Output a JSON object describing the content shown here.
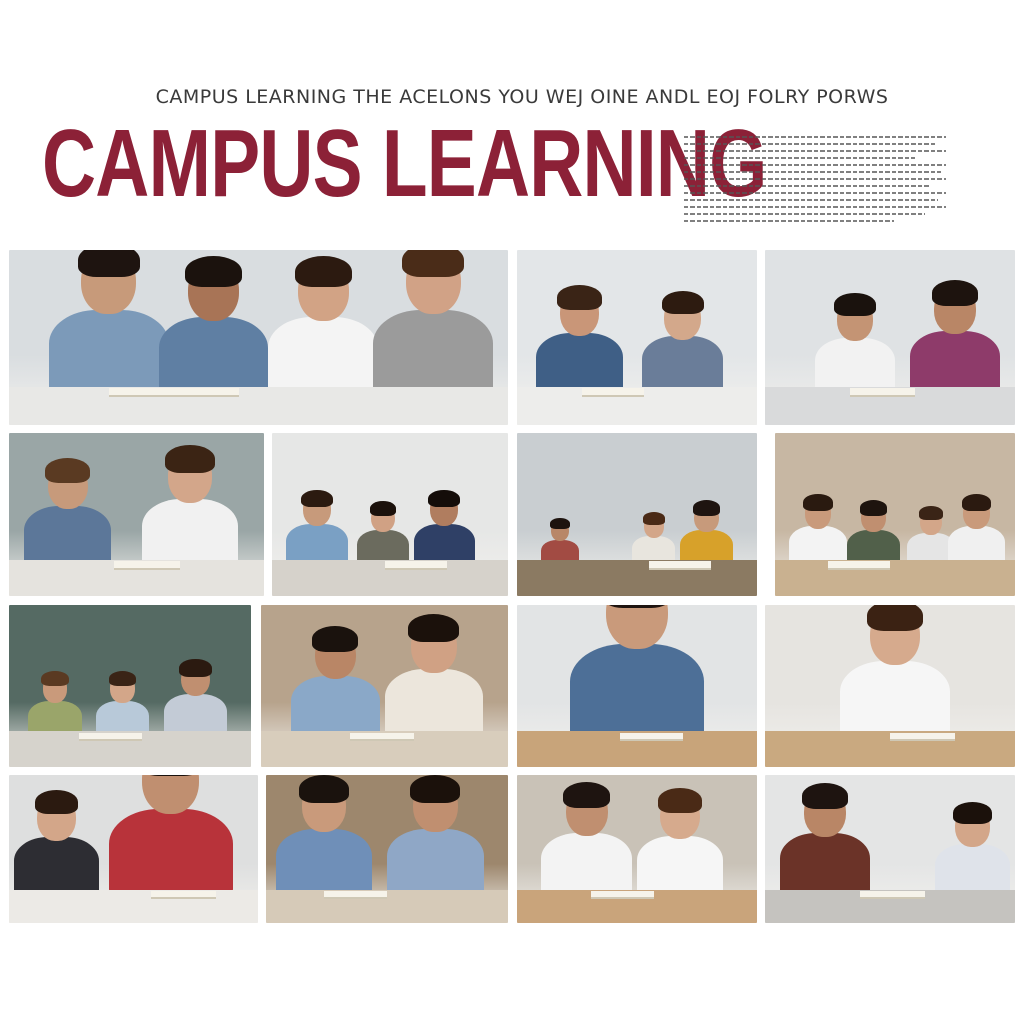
{
  "header": {
    "subtitle": "CAMPUS LEARNING THE ACELONS YOU WEJ OINE ANDL EOJ FOLRY PORWS",
    "title": "CAMPUS LEARNING"
  },
  "colors": {
    "title": "#8c2137",
    "subtitle": "#3a3a3a"
  },
  "photos": [
    {
      "name": "students-reading-group",
      "bg": "#d9dde0",
      "desk": "#e8e8e6",
      "people": [
        {
          "x": 8,
          "w": 24,
          "skin": "#c79a7a",
          "shirt": "#7c9ab9",
          "hair": "#1e1410"
        },
        {
          "x": 30,
          "w": 22,
          "skin": "#a87456",
          "shirt": "#5f7fa3",
          "hair": "#1b120d"
        },
        {
          "x": 52,
          "w": 22,
          "skin": "#d2a385",
          "shirt": "#f4f4f4",
          "hair": "#2c1a10"
        },
        {
          "x": 73,
          "w": 24,
          "skin": "#d1a286",
          "shirt": "#9b9b9b",
          "hair": "#4a2c18"
        }
      ]
    },
    {
      "name": "students-laptop-duo",
      "bg": "#e3e6e8",
      "desk": "#ededeb",
      "people": [
        {
          "x": 8,
          "w": 36,
          "skin": "#c99678",
          "shirt": "#3f5f86",
          "hair": "#3a2416"
        },
        {
          "x": 52,
          "w": 34,
          "skin": "#d3a88b",
          "shirt": "#6a7d99",
          "hair": "#2d1b10"
        }
      ]
    },
    {
      "name": "students-desk-pair",
      "bg": "#dfe2e4",
      "desk": "#d9dadb",
      "people": [
        {
          "x": 20,
          "w": 32,
          "skin": "#c49474",
          "shirt": "#f2f2f2",
          "hair": "#1a120d"
        },
        {
          "x": 58,
          "w": 36,
          "skin": "#b98666",
          "shirt": "#8e3b6a",
          "hair": "#1d130e"
        }
      ]
    },
    {
      "name": "students-study-window",
      "bg": "#9aa6a6",
      "desk": "#e5e3de",
      "people": [
        {
          "x": 6,
          "w": 34,
          "skin": "#c79a7b",
          "shirt": "#5c7799",
          "hair": "#5a3a22"
        },
        {
          "x": 52,
          "w": 38,
          "skin": "#d3a68a",
          "shirt": "#f1f1f1",
          "hair": "#3b2414"
        }
      ]
    },
    {
      "name": "students-classroom-whiteboard",
      "bg": "#e6e7e6",
      "desk": "#d6d2cb",
      "people": [
        {
          "x": 6,
          "w": 26,
          "skin": "#c79a7b",
          "shirt": "#7aa0c4",
          "hair": "#2b1a10"
        },
        {
          "x": 36,
          "w": 22,
          "skin": "#d0a184",
          "shirt": "#6b6b5e",
          "hair": "#1b110b"
        },
        {
          "x": 60,
          "w": 26,
          "skin": "#b07d5f",
          "shirt": "#2f4066",
          "hair": "#140d09"
        }
      ]
    },
    {
      "name": "students-library-hall",
      "bg": "#c9ced1",
      "desk": "#8b7a62",
      "people": [
        {
          "x": 10,
          "w": 16,
          "skin": "#b88768",
          "shirt": "#a24b43",
          "hair": "#1d130e"
        },
        {
          "x": 48,
          "w": 18,
          "skin": "#d3a689",
          "shirt": "#e8e5de",
          "hair": "#4a2a16"
        },
        {
          "x": 68,
          "w": 22,
          "skin": "#c79a7b",
          "shirt": "#d7a12a",
          "hair": "#1e1410"
        }
      ]
    },
    {
      "name": "students-group-table",
      "bg": "#c7b7a3",
      "desk": "#c9b190",
      "people": [
        {
          "x": 6,
          "w": 24,
          "skin": "#c99a7b",
          "shirt": "#f3f3f3",
          "hair": "#2a1a10"
        },
        {
          "x": 30,
          "w": 22,
          "skin": "#c08f70",
          "shirt": "#51604a",
          "hair": "#1e140e"
        },
        {
          "x": 55,
          "w": 20,
          "skin": "#d3a689",
          "shirt": "#e5e5e5",
          "hair": "#3a2416"
        },
        {
          "x": 72,
          "w": 24,
          "skin": "#c99a7b",
          "shirt": "#f0f0f0",
          "hair": "#2b1a10"
        }
      ]
    },
    {
      "name": "students-round-table",
      "bg": "#556a63",
      "desk": "#d6d3cc",
      "people": [
        {
          "x": 8,
          "w": 22,
          "skin": "#c99a7b",
          "shirt": "#9aa56a",
          "hair": "#5a3a22"
        },
        {
          "x": 36,
          "w": 22,
          "skin": "#d3a689",
          "shirt": "#b8c9d9",
          "hair": "#3a2416"
        },
        {
          "x": 64,
          "w": 26,
          "skin": "#c08f70",
          "shirt": "#c3cbd6",
          "hair": "#2b1a10"
        }
      ]
    },
    {
      "name": "students-library-reading",
      "bg": "#b7a38c",
      "desk": "#d8cdbc",
      "people": [
        {
          "x": 12,
          "w": 36,
          "skin": "#b98666",
          "shirt": "#8aa8c8",
          "hair": "#1a120d"
        },
        {
          "x": 50,
          "w": 40,
          "skin": "#d0a184",
          "shirt": "#ece6dc",
          "hair": "#1b110b"
        }
      ]
    },
    {
      "name": "student-writing-notes",
      "bg": "#e2e4e5",
      "desk": "#c8a47a",
      "people": [
        {
          "x": 22,
          "w": 56,
          "skin": "#c99a7b",
          "shirt": "#4d6f97",
          "hair": "#1e1410"
        }
      ]
    },
    {
      "name": "student-smiling-writing",
      "bg": "#e6e4e0",
      "desk": "#c9a980",
      "people": [
        {
          "x": 30,
          "w": 44,
          "skin": "#d6aa8d",
          "shirt": "#f6f6f6",
          "hair": "#3b2213"
        }
      ]
    },
    {
      "name": "students-notebook-pair",
      "bg": "#dedfdf",
      "desk": "#eceae6",
      "people": [
        {
          "x": 2,
          "w": 34,
          "skin": "#d3a689",
          "shirt": "#2d2d33",
          "hair": "#2b1a10"
        },
        {
          "x": 40,
          "w": 50,
          "skin": "#c08f70",
          "shirt": "#b8333a",
          "hair": "#1a120d"
        }
      ]
    },
    {
      "name": "students-bookshelf-pair",
      "bg": "#9d876d",
      "desk": "#d6cab8",
      "people": [
        {
          "x": 4,
          "w": 40,
          "skin": "#c99a7b",
          "shirt": "#6f8fb8",
          "hair": "#1a120d"
        },
        {
          "x": 50,
          "w": 40,
          "skin": "#c08f70",
          "shirt": "#8fa7c6",
          "hair": "#1b110b"
        }
      ]
    },
    {
      "name": "students-cafeteria-books",
      "bg": "#c9c2b7",
      "desk": "#c9a47b",
      "people": [
        {
          "x": 10,
          "w": 38,
          "skin": "#c08f70",
          "shirt": "#f3f3f3",
          "hair": "#1e1410"
        },
        {
          "x": 50,
          "w": 36,
          "skin": "#d6aa8d",
          "shirt": "#f6f6f6",
          "hair": "#4a2a16"
        }
      ]
    },
    {
      "name": "students-laptop-classroom",
      "bg": "#e4e5e5",
      "desk": "#c5c3bf",
      "people": [
        {
          "x": 6,
          "w": 36,
          "skin": "#b98666",
          "shirt": "#6b3328",
          "hair": "#1e1410"
        },
        {
          "x": 68,
          "w": 30,
          "skin": "#d3a689",
          "shirt": "#dfe3ea",
          "hair": "#1b110b"
        }
      ]
    }
  ]
}
